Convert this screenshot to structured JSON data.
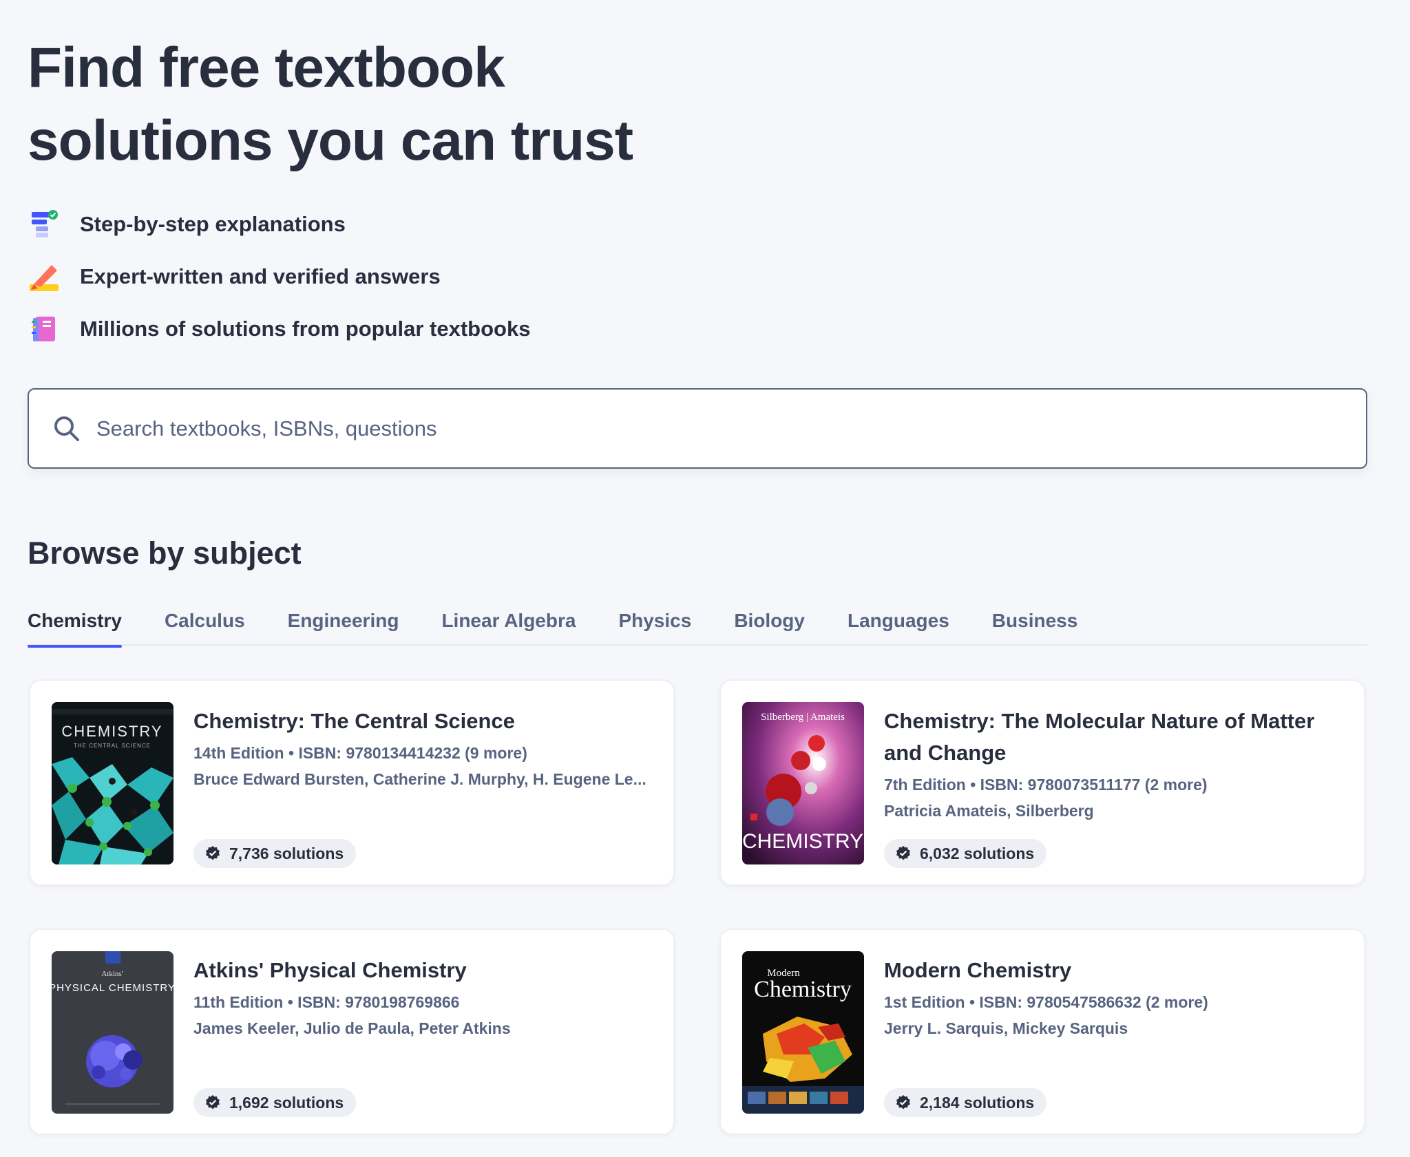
{
  "hero": {
    "title_line1": "Find free textbook",
    "title_line2": "solutions you can trust"
  },
  "features": [
    {
      "icon": "step-list-icon",
      "text": "Step-by-step explanations"
    },
    {
      "icon": "pencil-icon",
      "text": "Expert-written and verified answers"
    },
    {
      "icon": "notebook-icon",
      "text": "Millions of solutions from popular textbooks"
    }
  ],
  "search": {
    "placeholder": "Search textbooks, ISBNs, questions"
  },
  "browse": {
    "title": "Browse by subject",
    "tabs": [
      "Chemistry",
      "Calculus",
      "Engineering",
      "Linear Algebra",
      "Physics",
      "Biology",
      "Languages",
      "Business"
    ],
    "active_tab": "Chemistry"
  },
  "books": [
    {
      "title": "Chemistry: The Central Science",
      "edition_isbn": "14th Edition • ISBN: 9780134414232 (9 more)",
      "authors": "Bruce Edward Bursten, Catherine J. Murphy, H. Eugene Le...",
      "solutions": "7,736 solutions",
      "cover_text": "CHEMISTRY",
      "cover_subtext": "THE CENTRAL SCIENCE"
    },
    {
      "title": "Chemistry: The Molecular Nature of Matter and Change",
      "edition_isbn": "7th Edition • ISBN: 9780073511177 (2 more)",
      "authors": "Patricia Amateis, Silberberg",
      "solutions": "6,032 solutions",
      "cover_text": "CHEMISTRY",
      "cover_subtext": "Silberberg | Amateis"
    },
    {
      "title": "Atkins' Physical Chemistry",
      "edition_isbn": "11th Edition • ISBN: 9780198769866",
      "authors": "James Keeler, Julio de Paula, Peter Atkins",
      "solutions": "1,692 solutions",
      "cover_text": "PHYSICAL CHEMISTRY",
      "cover_subtext": "Atkins'"
    },
    {
      "title": "Modern Chemistry",
      "edition_isbn": "1st Edition • ISBN: 9780547586632 (2 more)",
      "authors": "Jerry L. Sarquis, Mickey Sarquis",
      "solutions": "2,184 solutions",
      "cover_text": "Chemistry",
      "cover_subtext": "Modern"
    }
  ],
  "colors": {
    "accent": "#4255ff",
    "text_primary": "#282e3e",
    "text_secondary": "#586380",
    "background": "#f6f7fb"
  }
}
